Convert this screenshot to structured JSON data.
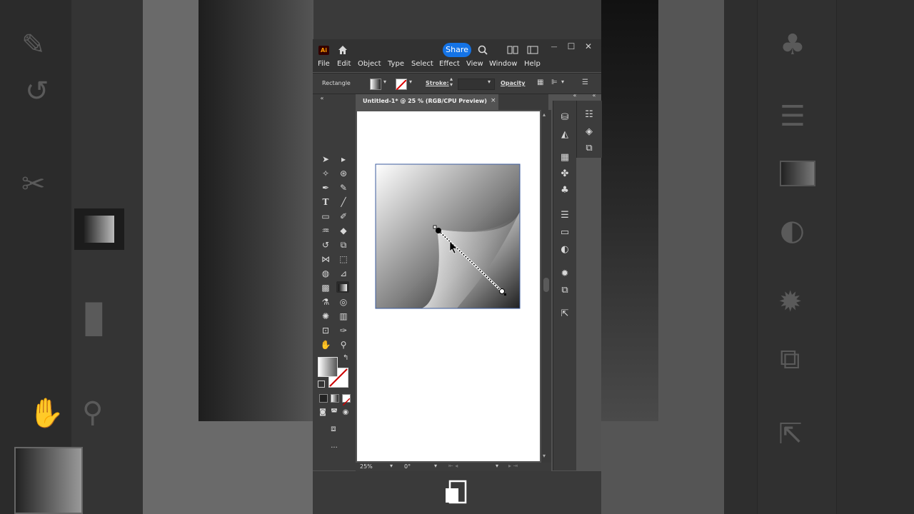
{
  "app": {
    "logo": "Ai",
    "share_label": "Share",
    "icons": [
      "home-icon",
      "search-icon",
      "arrange-documents-icon",
      "panel-icon",
      "minimize-icon",
      "maximize-icon",
      "close-icon"
    ],
    "window_controls": {
      "minimize": "—",
      "maximize": "☐",
      "close": "✕"
    }
  },
  "menu": [
    "File",
    "Edit",
    "Object",
    "Type",
    "Select",
    "Effect",
    "View",
    "Window",
    "Help"
  ],
  "options_bar": {
    "object_type": "Rectangle",
    "stroke_label": "Stroke:",
    "opacity_label": "Opacity"
  },
  "document": {
    "tab_title": "Untitled-1* @ 25 % (RGB/CPU Preview)",
    "tab_close": "×"
  },
  "status_bar": {
    "zoom": "25%",
    "rotation": "0°"
  },
  "toolbar": {
    "more_tools": "..."
  },
  "colors": {
    "accent": "#1473e6",
    "app_bg": "#535353",
    "panel_bg": "#3c3c3c",
    "titlebar_bg": "#323232",
    "logo_orange": "#ff9a00"
  }
}
